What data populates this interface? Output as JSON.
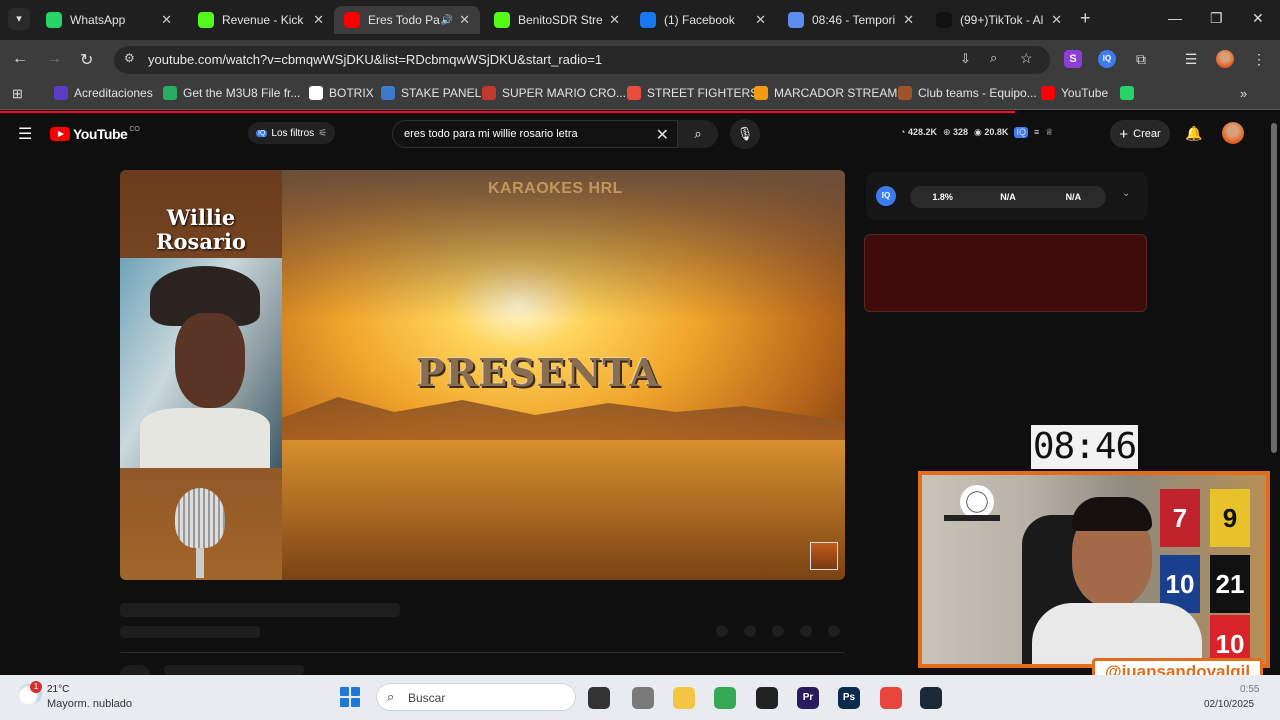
{
  "browser": {
    "tabs": [
      {
        "title": "WhatsApp",
        "color": "#25d366"
      },
      {
        "title": "Revenue - Kick D",
        "color": "#53fc18"
      },
      {
        "title": "Eres Todo Pa",
        "color": "#ff0000",
        "active": true
      },
      {
        "title": "BenitoSDR Strea",
        "color": "#53fc18"
      },
      {
        "title": "(1) Facebook",
        "color": "#1877f2"
      },
      {
        "title": "08:46 - Tempori",
        "color": "#5b8def"
      },
      {
        "title": "(99+)TikTok - Al",
        "color": "#111111"
      }
    ],
    "url": "youtube.com/watch?v=cbmqwWSjDKU&list=RDcbmqwWSjDKU&start_radio=1",
    "bookmarks": [
      {
        "label": "Acreditaciones",
        "color": "#5b3cc4"
      },
      {
        "label": "Get the M3U8 File fr...",
        "color": "#27ae60"
      },
      {
        "label": "BOTRIX",
        "color": "#ffffff"
      },
      {
        "label": "STAKE PANEL",
        "color": "#3f79c9"
      },
      {
        "label": "SUPER MARIO CRO...",
        "color": "#c0392b"
      },
      {
        "label": "STREET FIGHTERS",
        "color": "#e74c3c"
      },
      {
        "label": "MARCADOR STREAM",
        "color": "#f39c12"
      },
      {
        "label": "Club teams - Equipo...",
        "color": "#a0522d"
      },
      {
        "label": "YouTube",
        "color": "#ff0000"
      },
      {
        "label": "",
        "color": "#25d366"
      }
    ]
  },
  "youtube": {
    "logo": "YouTube",
    "country_code": "CO",
    "filters_label": "Los filtros",
    "search_query": "eres todo para mi willie rosario letra",
    "stats": [
      "428.2K",
      "328",
      "20.8K"
    ],
    "create_label": "Crear"
  },
  "video": {
    "channel_banner": "KARAOKES HRL",
    "artist_name_line1": "Willie",
    "artist_name_line2": "Rosario",
    "center_text": "PRESENTA"
  },
  "extension": {
    "badge": "IQ",
    "pills": [
      "1.8%",
      "N/A",
      "N/A"
    ]
  },
  "overlay": {
    "clock": "08:46",
    "handle": "@juansandovalgil",
    "jerseys": [
      {
        "number": "7",
        "color": "#c0232b"
      },
      {
        "number": "9",
        "color": "#e7c22b"
      },
      {
        "number": "10",
        "color": "#1b3f8f"
      },
      {
        "number": "21",
        "color": "#111111"
      },
      {
        "number": "10",
        "color": "#d9232b"
      }
    ]
  },
  "taskbar": {
    "weather_temp": "21°C",
    "weather_desc": "Mayorm. nublado",
    "notification_count": "1",
    "search_placeholder": "Buscar",
    "time": "0:55",
    "date": "02/10/2025",
    "apps": [
      {
        "name": "task-view",
        "label": "",
        "color": "#333333"
      },
      {
        "name": "clock-app",
        "label": "",
        "color": "#7a7a7a"
      },
      {
        "name": "file-explorer",
        "label": "",
        "color": "#f4c542"
      },
      {
        "name": "chrome",
        "label": "",
        "color": "#34a853"
      },
      {
        "name": "obs",
        "label": "",
        "color": "#222222"
      },
      {
        "name": "premiere",
        "label": "Pr",
        "color": "#2a1a5e"
      },
      {
        "name": "photoshop",
        "label": "Ps",
        "color": "#0a2a4e"
      },
      {
        "name": "chrome-2",
        "label": "",
        "color": "#e8453c"
      },
      {
        "name": "steam",
        "label": "",
        "color": "#1b2838"
      }
    ]
  }
}
